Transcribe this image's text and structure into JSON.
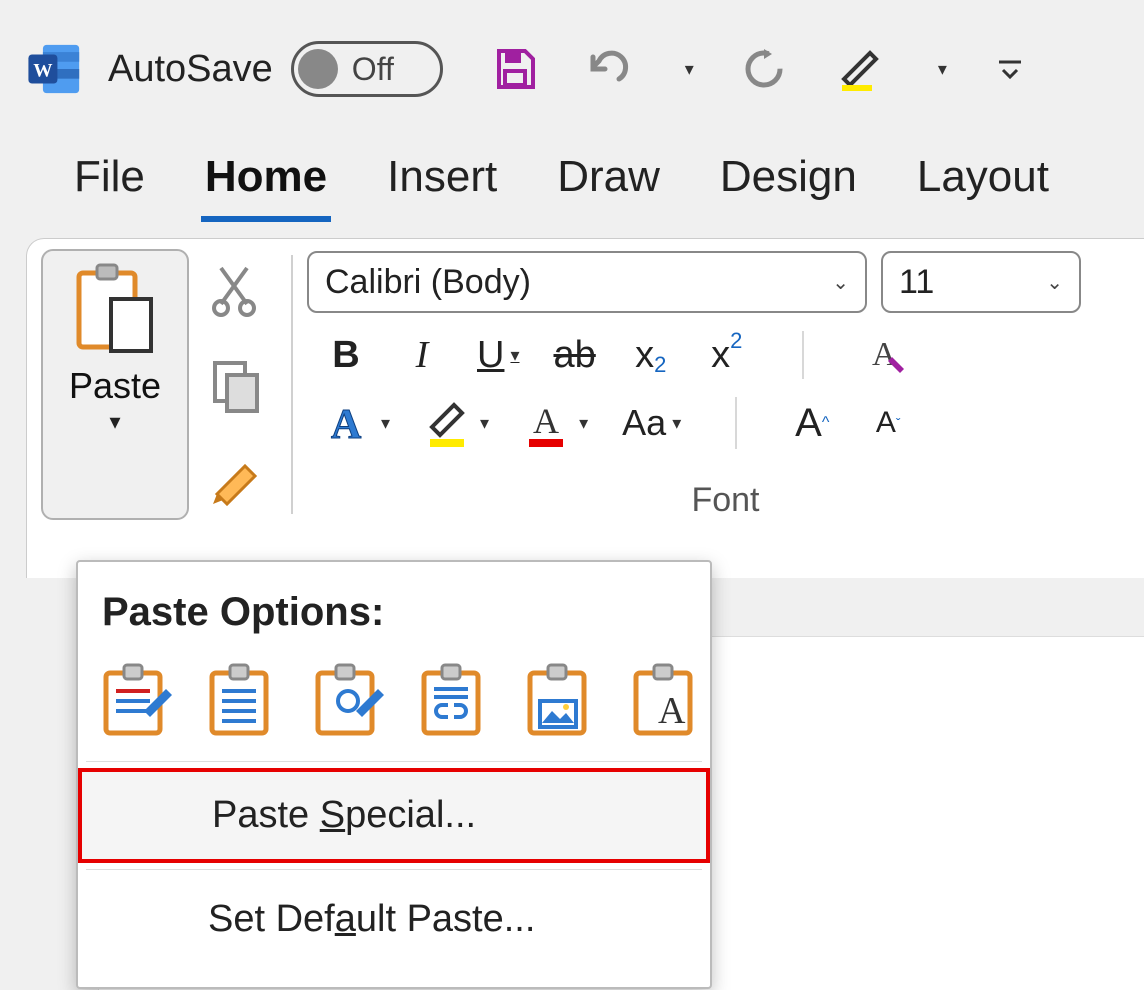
{
  "titlebar": {
    "autosave_label": "AutoSave",
    "autosave_state": "Off"
  },
  "tabs": [
    "File",
    "Home",
    "Insert",
    "Draw",
    "Design",
    "Layout"
  ],
  "active_tab": "Home",
  "ribbon": {
    "paste_label": "Paste",
    "font_name": "Calibri (Body)",
    "font_size": "11",
    "group_label_font": "Font",
    "bold": "B",
    "italic": "I",
    "underline": "U",
    "strike": "ab",
    "subscript": "x",
    "subscript_mark": "2",
    "superscript": "x",
    "superscript_mark": "2",
    "texteffects": "A",
    "highlight": "A",
    "fontcolor": "A",
    "changecase": "Aa",
    "grow": "A",
    "shrink": "A",
    "clearfmt": "A"
  },
  "menu": {
    "title": "Paste Options:",
    "item_special": "Paste Special...",
    "item_default": "Set Default Paste..."
  }
}
